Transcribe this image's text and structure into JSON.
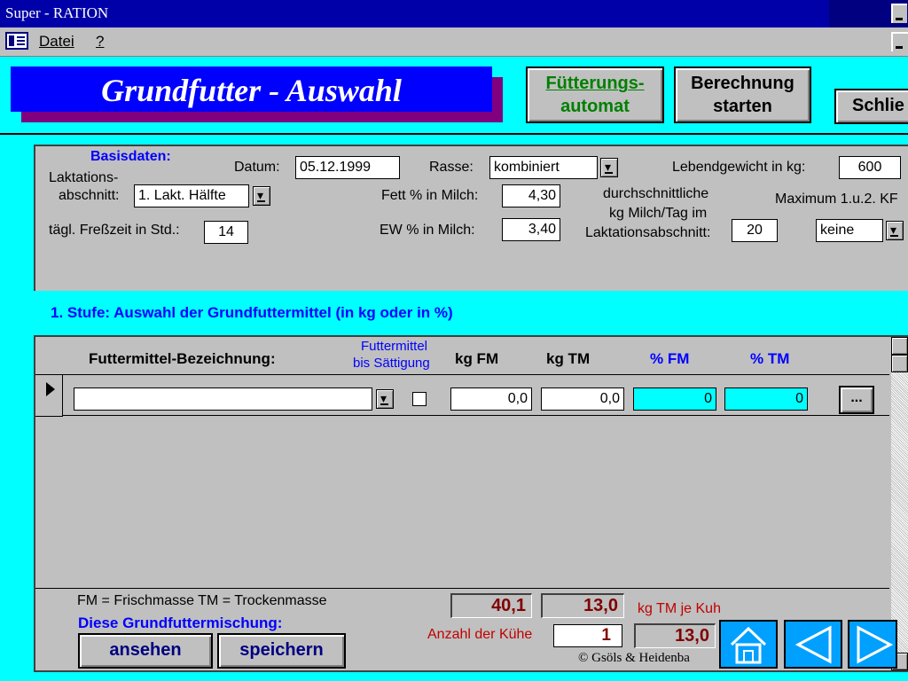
{
  "window": {
    "title": "Super - RATION"
  },
  "menu": {
    "datei": "Datei",
    "help": "?"
  },
  "header": {
    "title": "Grundfutter - Auswahl",
    "btn_fuetterung_1": "Fütterungs-",
    "btn_fuetterung_2": "automat",
    "btn_berechnung_1": "Berechnung",
    "btn_berechnung_2": "starten",
    "btn_schliessen": "Schlie"
  },
  "basis": {
    "heading": "Basisdaten:",
    "datum_label": "Datum:",
    "datum_value": "05.12.1999",
    "rasse_label": "Rasse:",
    "rasse_value": "kombiniert",
    "lebendgewicht_label": "Lebendgewicht in kg:",
    "lebendgewicht_value": "600",
    "laktation_label_1": "Laktations-",
    "laktation_label_2": "abschnitt:",
    "laktation_value": "1. Lakt. Hälfte",
    "fett_label": "Fett % in Milch:",
    "fett_value": "4,30",
    "durchschnitt_1": "durchschnittliche",
    "durchschnitt_2": "kg Milch/Tag im",
    "durchschnitt_3": "Laktationsabschnitt:",
    "milch_value": "20",
    "maximum_label": "Maximum 1.u.2. KF",
    "maximum_value": "keine",
    "fresszeit_label": "tägl. Freßzeit in Std.:",
    "fresszeit_value": "14",
    "ew_label": "EW % in Milch:",
    "ew_value": "3,40"
  },
  "stufe": {
    "heading": "1. Stufe:  Auswahl der Grundfuttermittel (in kg oder in %)"
  },
  "grid": {
    "col_bezeichnung": "Futtermittel-Bezeichnung:",
    "col_saettigung_1": "Futtermittel",
    "col_saettigung_2": "bis Sättigung",
    "col_kgfm": "kg FM",
    "col_kgtm": "kg TM",
    "col_pfm": "% FM",
    "col_ptm": "% TM",
    "row": {
      "bezeichnung": "",
      "kgfm": "0,0",
      "kgtm": "0,0",
      "pfm": "0",
      "ptm": "0",
      "more": "..."
    }
  },
  "footer": {
    "legend": "FM = Frischmasse    TM = Trockenmasse",
    "mix_label": "Diese Grundfuttermischung:",
    "btn_ansehen": "ansehen",
    "btn_speichern": "speichern",
    "sum_fm": "40,1",
    "sum_tm": "13,0",
    "kg_tm_label": "kg TM je Kuh",
    "anzahl_label": "Anzahl der Kühe",
    "anzahl_value": "1",
    "total_tm": "13,0",
    "copyright": "© Gsöls & Heidenba"
  },
  "colors": {
    "accent": "#0000ff",
    "background": "#00ffff",
    "nav": "#00a0ff"
  },
  "icons": {
    "home": "home-icon",
    "back": "arrow-left-icon",
    "forward": "arrow-right-icon"
  }
}
